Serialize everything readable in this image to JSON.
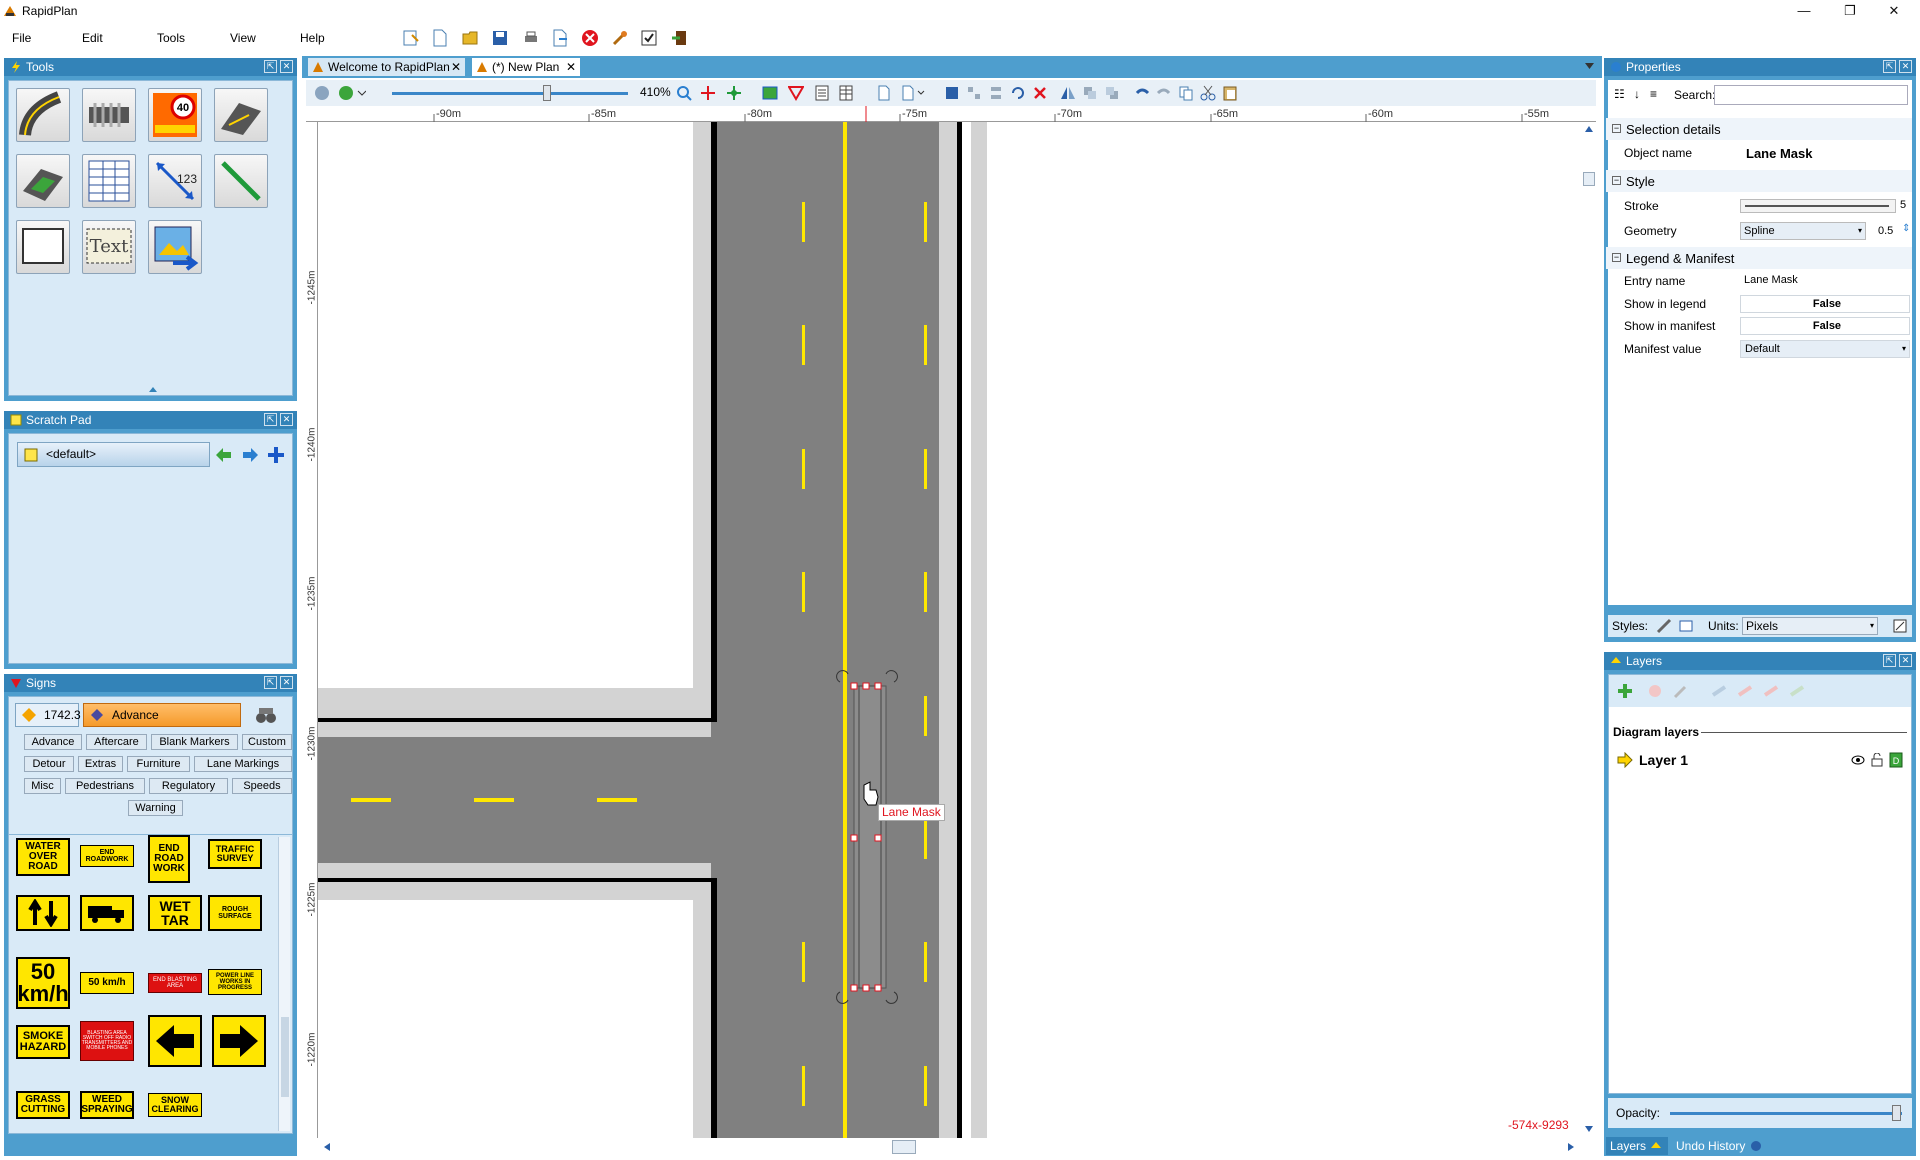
{
  "app": {
    "title": "RapidPlan"
  },
  "menu": [
    "File",
    "Edit",
    "Tools",
    "View",
    "Help"
  ],
  "tabs": [
    {
      "label": "Welcome to RapidPlan"
    },
    {
      "label": "(*) New Plan"
    }
  ],
  "panels": {
    "tools": {
      "title": "Tools",
      "text_tool_label": "Text",
      "measure_label": "123"
    },
    "scratchpad": {
      "title": "Scratch Pad",
      "selected": "<default>"
    },
    "signs": {
      "title": "Signs",
      "standard": "1742.3",
      "category": "Advance",
      "filters": [
        "Advance",
        "Aftercare",
        "Blank Markers",
        "Custom",
        "Detour",
        "Extras",
        "Furniture",
        "Lane Markings",
        "Misc",
        "Pedestrians",
        "Regulatory",
        "Speeds",
        "Warning"
      ],
      "items": [
        "WATER OVER ROAD",
        "END ROADWORK",
        "END ROAD WORK",
        "TRAFFIC SURVEY",
        "WET TAR",
        "ROUGH SURFACE",
        "50 km/h",
        "50 km/h",
        "END BLASTING AREA",
        "POWER LINE WORKS IN PROGRESS",
        "SMOKE HAZARD",
        "BLASTING AREA SWITCH OFF RADIO TRANSMITTERS AND MOBILE PHONES",
        "GRASS CUTTING",
        "WEED SPRAYING",
        "SNOW CLEARING"
      ]
    },
    "properties": {
      "title": "Properties",
      "search_label": "Search:",
      "search_value": "",
      "sections": {
        "selection": "Selection details",
        "style": "Style",
        "legend": "Legend & Manifest"
      },
      "object_name_label": "Object name",
      "object_name": "Lane Mask",
      "stroke_label": "Stroke",
      "stroke_value": "5",
      "geometry_label": "Geometry",
      "geometry_value": "Spline",
      "geometry_num": "0.5",
      "entry_name_label": "Entry name",
      "entry_name": "Lane Mask",
      "show_legend_label": "Show in legend",
      "show_legend": "False",
      "show_manifest_label": "Show in manifest",
      "show_manifest": "False",
      "manifest_value_label": "Manifest value",
      "manifest_value": "Default",
      "styles_label": "Styles:",
      "units_label": "Units:",
      "units_value": "Pixels"
    },
    "layers": {
      "title": "Layers",
      "diagram_layers": "Diagram layers",
      "layer_name": "Layer 1",
      "opacity_label": "Opacity:",
      "opacity": 1,
      "bottom_tabs": [
        "Layers",
        "Undo History"
      ]
    }
  },
  "canvas": {
    "zoom": "410%",
    "ruler_top": [
      "-90m",
      "-85m",
      "-80m",
      "-75m",
      "-70m",
      "-65m",
      "-60m",
      "-55m"
    ],
    "ruler_left": [
      "-1245m",
      "-1240m",
      "-1235m",
      "-1230m",
      "-1225m",
      "-1220m"
    ],
    "selection_label": "Lane Mask",
    "coords": "-574x-9293"
  },
  "colors": {
    "panel": "#4e9ece",
    "header": "#3383b8",
    "road": "#808080",
    "center_line": "#ffe800",
    "accent_red": "#e0151f"
  }
}
